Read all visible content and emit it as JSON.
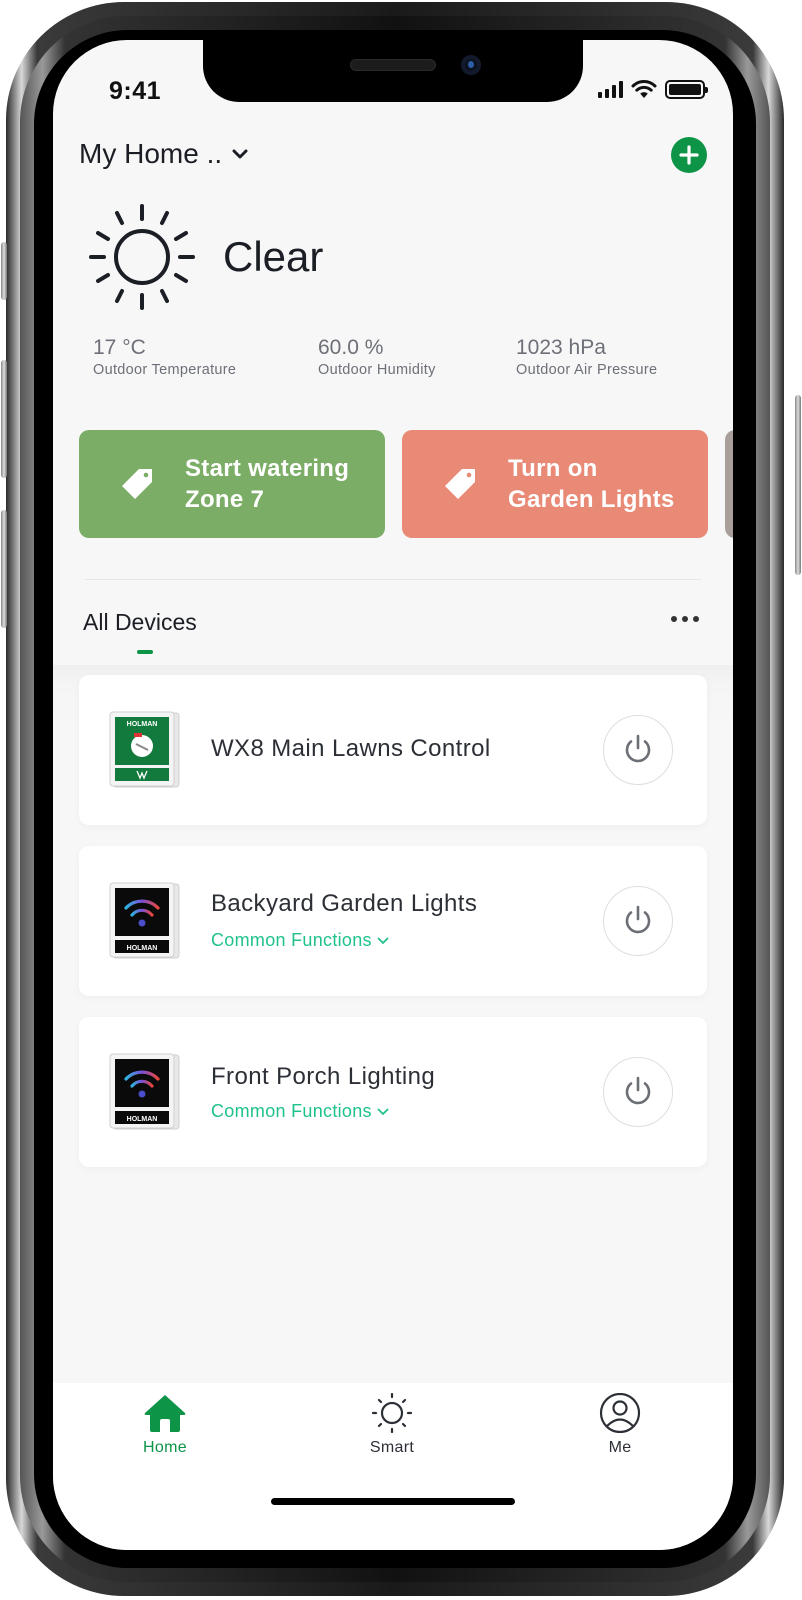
{
  "status_bar": {
    "time": "9:41"
  },
  "header": {
    "home_name": "My Home ..",
    "add_button_label": "+"
  },
  "weather": {
    "condition": "Clear",
    "icon": "sun-icon",
    "stats": [
      {
        "value": "17 °C",
        "label": "Outdoor Temperature"
      },
      {
        "value": "60.0 %",
        "label": "Outdoor Humidity"
      },
      {
        "value": "1023 hPa",
        "label": "Outdoor Air Pressure"
      }
    ]
  },
  "scenes": [
    {
      "line1": "Start watering",
      "line2": "Zone 7",
      "color": "#7cad66",
      "icon": "tag-icon"
    },
    {
      "line1": "Turn on",
      "line2": "Garden Lights",
      "color": "#e98a76",
      "icon": "tag-icon"
    },
    {
      "line1": "",
      "line2": "",
      "color": "#a89e9a",
      "icon": ""
    }
  ],
  "devices_section": {
    "title": "All Devices",
    "more_label": "more-options"
  },
  "devices": [
    {
      "name": "WX8 Main Lawns Control",
      "subtitle": "",
      "thumbnail": "holman-wx8-controller",
      "brand": "HOLMAN"
    },
    {
      "name": "Backyard Garden Lights",
      "subtitle": "Common Functions",
      "thumbnail": "holman-wifi-light-controller",
      "brand": "HOLMAN"
    },
    {
      "name": "Front Porch Lighting",
      "subtitle": "Common Functions",
      "thumbnail": "holman-wifi-light-controller",
      "brand": "HOLMAN"
    }
  ],
  "tabbar": {
    "tabs": [
      {
        "label": "Home",
        "icon": "home-icon",
        "active": true
      },
      {
        "label": "Smart",
        "icon": "sun-icon",
        "active": false
      },
      {
        "label": "Me",
        "icon": "user-icon",
        "active": false
      }
    ]
  },
  "colors": {
    "accent": "#0d9447",
    "link": "#1fc28d",
    "text_primary": "#1b1e24",
    "text_secondary": "#6d7078",
    "background": "#f7f7f7"
  }
}
